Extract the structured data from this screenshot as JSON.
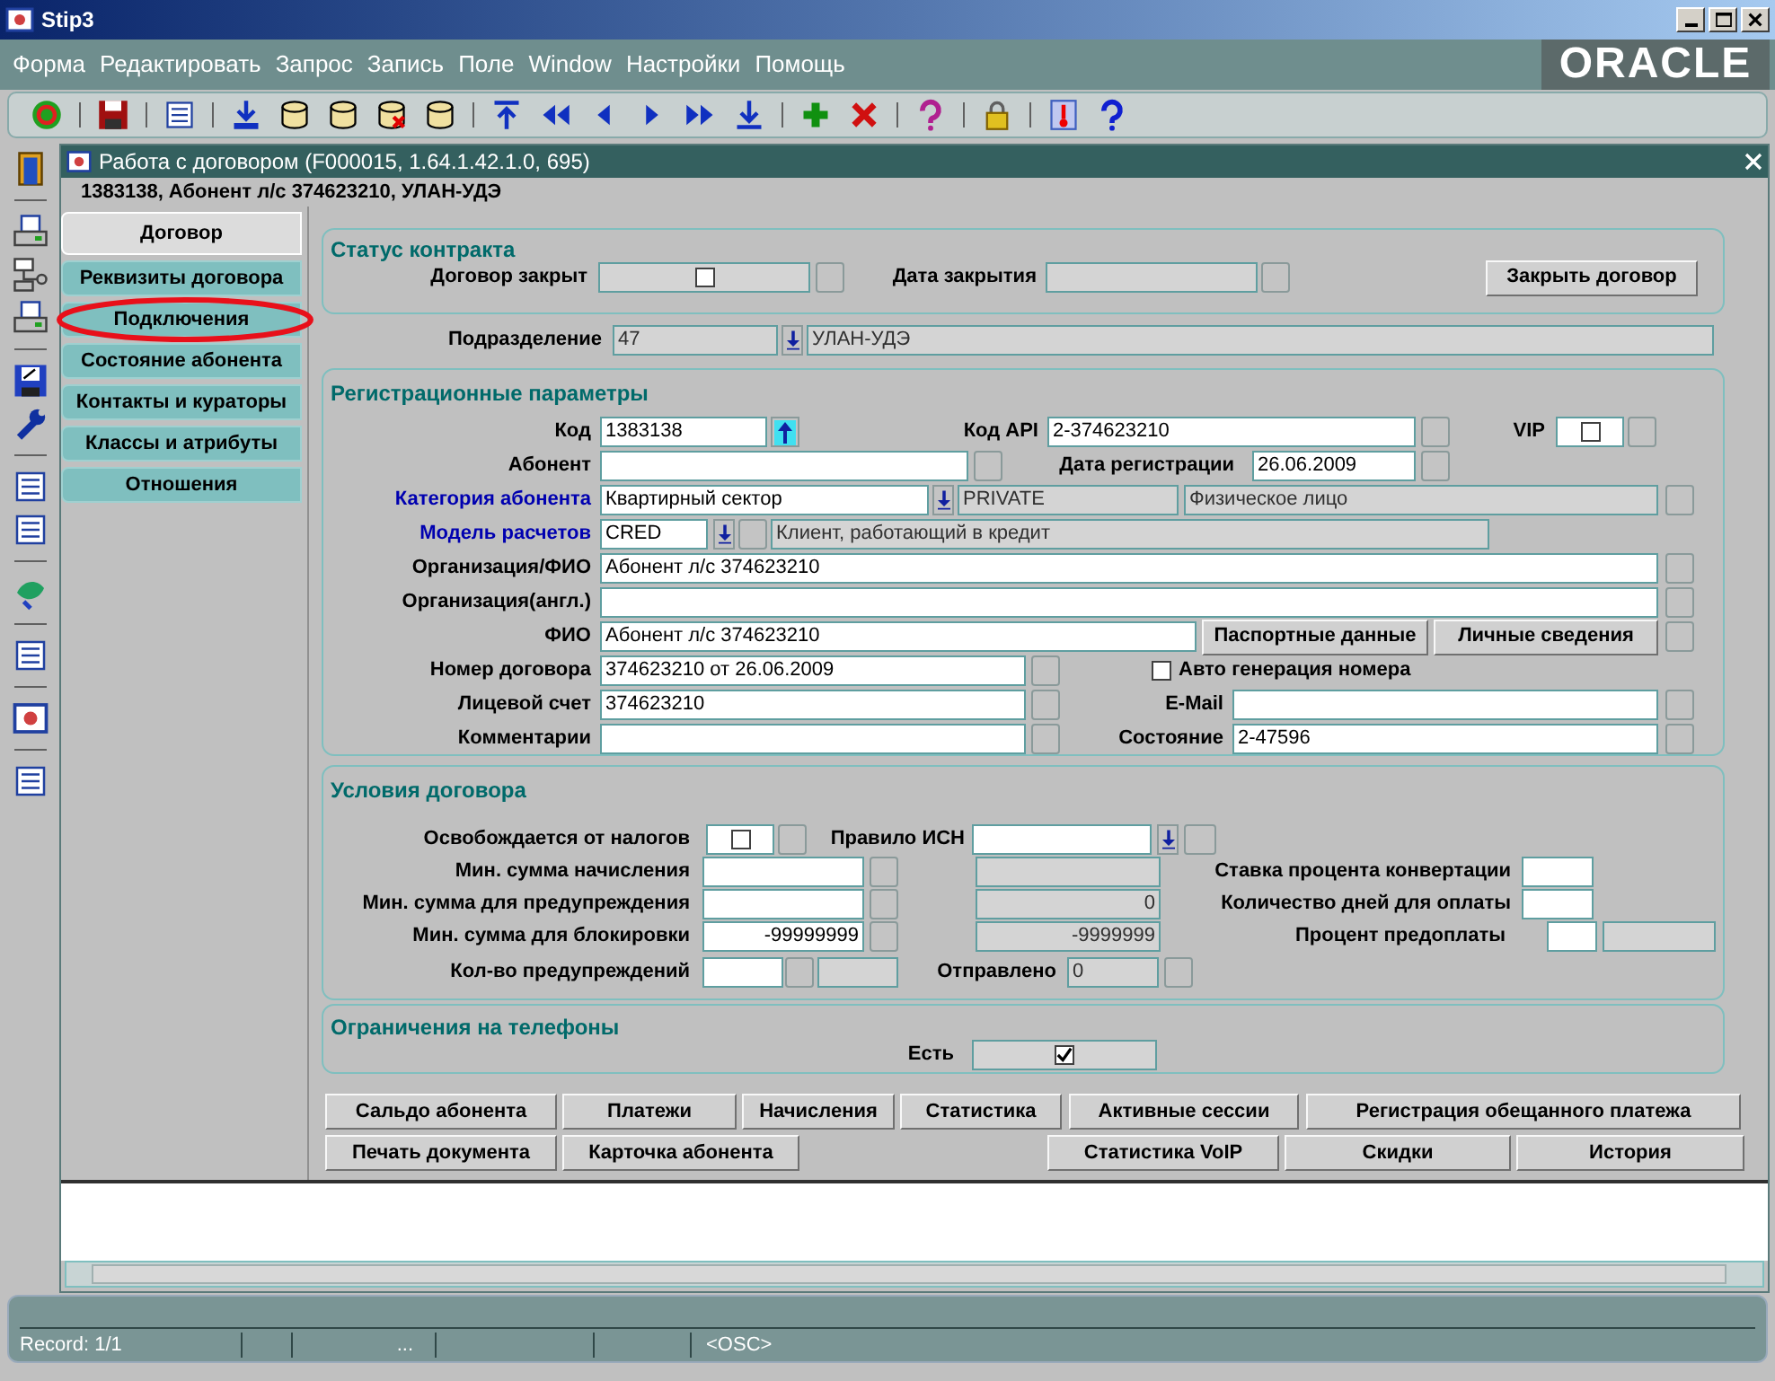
{
  "window": {
    "title": "Stip3"
  },
  "menu": [
    "Форма",
    "Редактировать",
    "Запрос",
    "Запись",
    "Поле",
    "Window",
    "Настройки",
    "Помощь"
  ],
  "brand": "ORACLE",
  "form": {
    "title": "Работа с договором (F000015, 1.64.1.42.1.0, 695)",
    "header": "1383138, Абонент л/с 374623210, УЛАН-УДЭ"
  },
  "tabs": [
    {
      "label": "Договор",
      "selected": true,
      "circled": false
    },
    {
      "label": "Реквизиты договора",
      "selected": false,
      "circled": false
    },
    {
      "label": "Подключения",
      "selected": false,
      "circled": true
    },
    {
      "label": "Состояние абонента",
      "selected": false,
      "circled": false
    },
    {
      "label": "Контакты и кураторы",
      "selected": false,
      "circled": false
    },
    {
      "label": "Классы и атрибуты",
      "selected": false,
      "circled": false
    },
    {
      "label": "Отношения",
      "selected": false,
      "circled": false
    }
  ],
  "contract_status": {
    "title": "Статус контракта",
    "closed": {
      "label": "Договор закрыт",
      "checked": false
    },
    "close_date": {
      "label": "Дата закрытия"
    },
    "close_button": "Закрыть договор"
  },
  "division": {
    "label": "Подразделение",
    "code": "47",
    "name": "УЛАН-УДЭ"
  },
  "registration": {
    "title": "Регистрационные параметры",
    "code": {
      "label": "Код",
      "value": "1383138"
    },
    "api_code": {
      "label": "Код API",
      "value": "2-374623210"
    },
    "vip": {
      "label": "VIP",
      "checked": false
    },
    "subscriber": {
      "label": "Абонент"
    },
    "reg_date": {
      "label": "Дата регистрации",
      "value": "26.06.2009"
    },
    "category": {
      "label": "Категория абонента",
      "value": "Квартирный сектор",
      "code": "PRIVATE",
      "type": "Физическое лицо"
    },
    "billing_model": {
      "label": "Модель расчетов",
      "value": "CRED",
      "description": "Клиент, работающий в кредит"
    },
    "organization": {
      "label": "Организация/ФИО",
      "value": "Абонент л/с 374623210"
    },
    "organization_en": {
      "label": "Организация(англ.)"
    },
    "full_name": {
      "label": "ФИО",
      "value": "Абонент л/с 374623210"
    },
    "passport_button": "Паспортные данные",
    "personal_button": "Личные сведения",
    "contract_number": {
      "label": "Номер договора",
      "value": "374623210 от 26.06.2009"
    },
    "auto_number": {
      "label": "Авто генерация номера",
      "checked": false
    },
    "account": {
      "label": "Лицевой счет",
      "value": "374623210"
    },
    "email": {
      "label": "E-Mail"
    },
    "comments": {
      "label": "Комментарии"
    },
    "state": {
      "label": "Состояние",
      "value": "2-47596"
    }
  },
  "terms": {
    "title": "Условия договора",
    "tax_exempt": {
      "label": "Освобождается от налогов",
      "checked": false
    },
    "isn_rule": {
      "label": "Правило ИСН"
    },
    "min_charge": {
      "label": "Мин. сумма начисления"
    },
    "min_warning": {
      "label": "Мин. сумма для предупреждения",
      "current": "0"
    },
    "min_block": {
      "label": "Мин. сумма для блокировки",
      "value": "-99999999",
      "current": "-9999999"
    },
    "warnings_count": {
      "label": "Кол-во предупреждений"
    },
    "sent": {
      "label": "Отправлено",
      "value": "0"
    },
    "conversion_rate": {
      "label": "Ставка процента конвертации"
    },
    "payment_days": {
      "label": "Количество дней для оплаты"
    },
    "prepayment": {
      "label": "Процент предоплаты"
    }
  },
  "phone_limits": {
    "title": "Ограничения на телефоны",
    "exists": {
      "label": "Есть",
      "checked": true
    }
  },
  "action_buttons": {
    "row_1": [
      "Сальдо абонента",
      "Платежи",
      "Начисления",
      "Статистика",
      "Активные сессии",
      "Регистрация обещанного платежа"
    ],
    "row_2_left": [
      "Печать документа",
      "Карточка абонента"
    ],
    "row_2_right": [
      "Статистика VoIP",
      "Скидки",
      "История"
    ]
  },
  "status_bar": {
    "record": "Record: 1/1",
    "field_3": "...",
    "mode": "<OSC>"
  }
}
